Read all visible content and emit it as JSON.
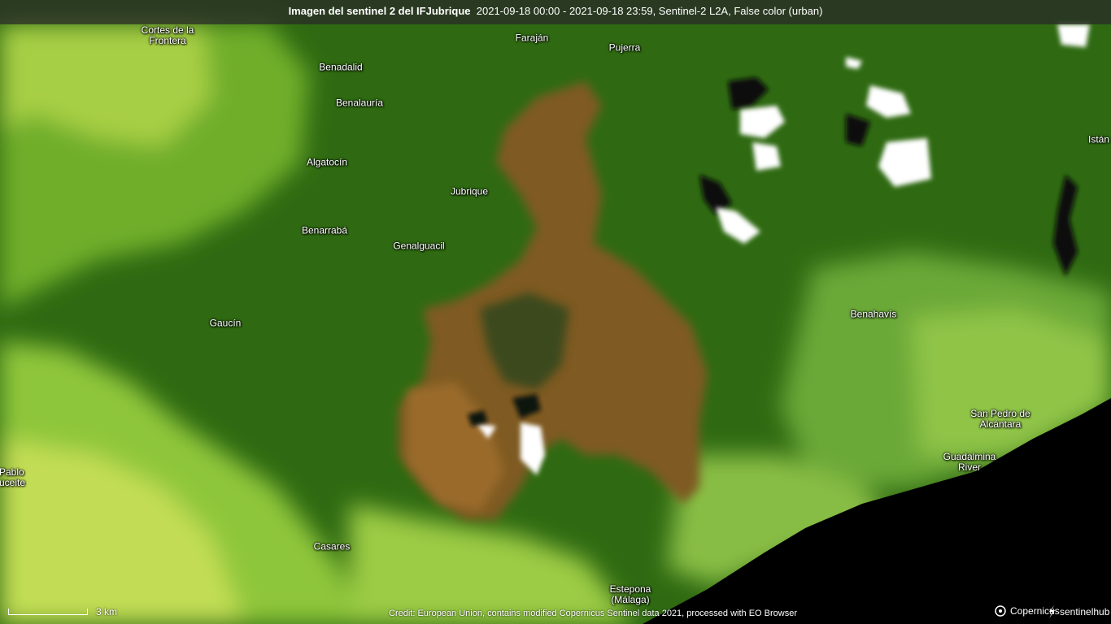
{
  "header": {
    "title": "Imagen del sentinel 2 del IFJubrique",
    "subtitle": "2021-09-18 00:00 - 2021-09-18 23:59, Sentinel-2 L2A, False color (urban)"
  },
  "places": {
    "cortes": "Cortes de la\nFrontera",
    "farajan": "Faraján",
    "pujerra": "Pujerra",
    "benadalid": "Benadalid",
    "benalauria": "Benalauría",
    "algatocin": "Algatocín",
    "jubrique": "Jubrique",
    "benarraba": "Benarrabá",
    "genalguacil": "Genalguacil",
    "gaucin": "Gaucín",
    "istan": "Istán",
    "benahavis": "Benahavís",
    "sanpedro": "San Pedro de\nAlcántara",
    "guadalmina": "Guadalmina\nRiver",
    "pablo": "Pablo\nuceite",
    "casares": "Casares",
    "estepona": "Estepona\n(Málaga)"
  },
  "scale": {
    "label": "3 km"
  },
  "credit": "Credit: European Union, contains modified Copernicus Sentinel data 2021, processed with EO Browser",
  "logos": {
    "copernicus": "Copernicus",
    "sentinelhub": "sentinelhub"
  },
  "colors": {
    "forest": "#2f6a12",
    "farmland": "#b7d84a",
    "burn_scar": "#8a6224",
    "sea": "#000000",
    "cloud": "#ffffff",
    "reservoir": "#0a0f0a"
  }
}
